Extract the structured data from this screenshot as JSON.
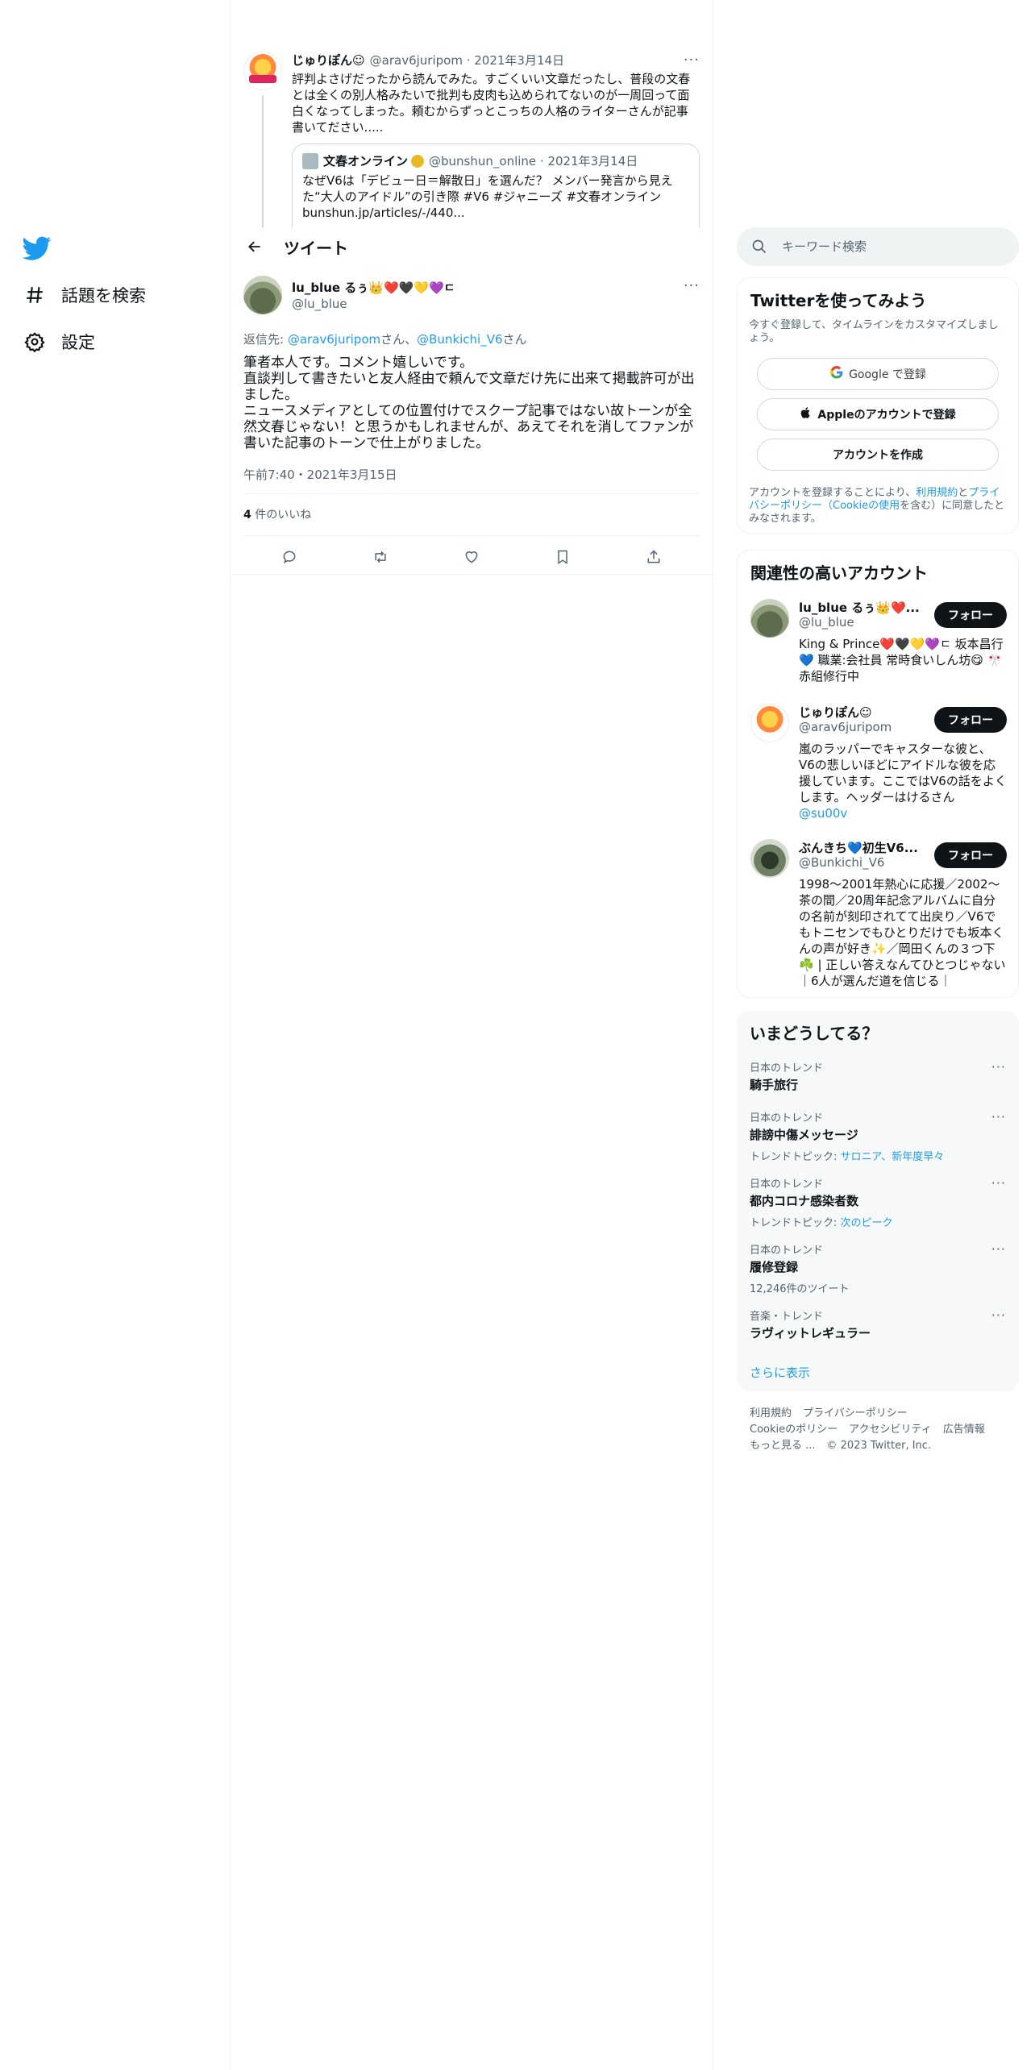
{
  "nav": {
    "items": [
      {
        "label": "話題を検索",
        "icon": "hashtag-icon"
      },
      {
        "label": "設定",
        "icon": "gear-icon"
      }
    ]
  },
  "quoted_thread": {
    "name": "じゅりぽん☺",
    "handle": "@arav6juripom",
    "date": "2021年3月14日",
    "text": "評判よさげだったから読んでみた。すごくいい文章だったし、普段の文春とは全くの別人格みたいで批判も皮肉も込められてないのが一周回って面白くなってしまった。頼むからずっとこっちの人格のライターさんが記事書いてださい.....",
    "card": {
      "name": "文春オンライン",
      "handle": "@bunshun_online",
      "date": "2021年3月14日",
      "text": "なぜV6は「デビュー日＝解散日」を選んだ？ メンバー発言から見えた“大人のアイドル”の引き際 #V6 #ジャニーズ #文春オンライン bunshun.jp/articles/-/440..."
    }
  },
  "header": {
    "title": "ツイート"
  },
  "tweet": {
    "name": "lu_blue るぅ👑❤️🖤💛💜ㄷ",
    "handle": "@lu_blue",
    "reply_prefix": "返信先: ",
    "reply_to_1": "@arav6juripom",
    "reply_sep": "さん、",
    "reply_to_2": "@Bunkichi_V6",
    "reply_suffix": "さん",
    "text_lines": [
      "筆者本人です。コメント嬉しいです。",
      "直談判して書きたいと友人経由で頼んで文章だけ先に出来て掲載許可が出ました。",
      "ニュースメディアとしての位置付けでスクープ記事ではない故トーンが全然文春じゃない！と思うかもしれませんが、あえてそれを消してファンが書いた記事のトーンで仕上がりました。"
    ],
    "time": "午前7:40・2021年3月15日",
    "likes_count": "4",
    "likes_label": " 件のいいね"
  },
  "search": {
    "placeholder": "キーワード検索"
  },
  "signup": {
    "title": "Twitterを使ってみよう",
    "subtitle": "今すぐ登録して、タイムラインをカスタマイズしましょう。",
    "google": "Google で登録",
    "apple": "Appleのアカウントで登録",
    "create": "アカウントを作成",
    "terms_1": "アカウントを登録することにより、",
    "terms_link1": "利用規約",
    "terms_2": "と",
    "terms_link2": "プライバシーポリシー（Cookieの使用",
    "terms_3": "を含む）に同意したとみなされます。"
  },
  "who_to_follow": {
    "title": "関連性の高いアカウント",
    "follow_label": "フォロー",
    "accounts": [
      {
        "name": "lu_blue るぅ👑❤️...",
        "handle": "@lu_blue",
        "bio": "King & Prince❤️🖤💛💜ㄷ 坂本昌行💙 職業:会社員 常時食いしん坊😋 🎌赤組修行中"
      },
      {
        "name": "じゅりぽん☺",
        "handle": "@arav6juripom",
        "bio": "嵐のラッパーでキャスターな彼と、V6の悲しいほどにアイドルな彼を応援しています。ここではV6の話をよくします。ヘッダーはけるさん ",
        "bio_link": "@su00v"
      },
      {
        "name": "ぶんきち💙初生V6...",
        "handle": "@Bunkichi_V6",
        "bio": "1998〜2001年熱心に応援／2002〜茶の間／20周年記念アルバムに自分の名前が刻印されてて出戻り／V6でもトニセンでもひとりだけでも坂本くんの声が好き✨／岡田くんの３つ下☘️ | 正しい答えなんてひとつじゃない ｜6人が選んだ道を信じる｜"
      }
    ]
  },
  "trends": {
    "title": "いまどうしてる？",
    "items": [
      {
        "category": "日本のトレンド",
        "name": "騎手旅行",
        "meta_label": "",
        "meta_link": ""
      },
      {
        "category": "日本のトレンド",
        "name": "誹謗中傷メッセージ",
        "meta_label": "トレンドトピック: ",
        "meta_link": "サロニア、新年度早々"
      },
      {
        "category": "日本のトレンド",
        "name": "都内コロナ感染者数",
        "meta_label": "トレンドトピック: ",
        "meta_link": "次のピーク"
      },
      {
        "category": "日本のトレンド",
        "name": "履修登録",
        "meta_label": "12,246件のツイート",
        "meta_link": ""
      },
      {
        "category": "音楽・トレンド",
        "name": "ラヴィットレギュラー",
        "meta_label": "",
        "meta_link": ""
      }
    ],
    "show_more": "さらに表示"
  },
  "footer": {
    "links": [
      "利用規約",
      "プライバシーポリシー",
      "Cookieのポリシー",
      "アクセシビリティ",
      "広告情報",
      "もっと見る ..."
    ],
    "copyright": "© 2023 Twitter, Inc."
  },
  "colors": {
    "accent": "#1d9bf0",
    "text": "#0f1419",
    "muted": "#536471",
    "border": "#eff3f4"
  }
}
